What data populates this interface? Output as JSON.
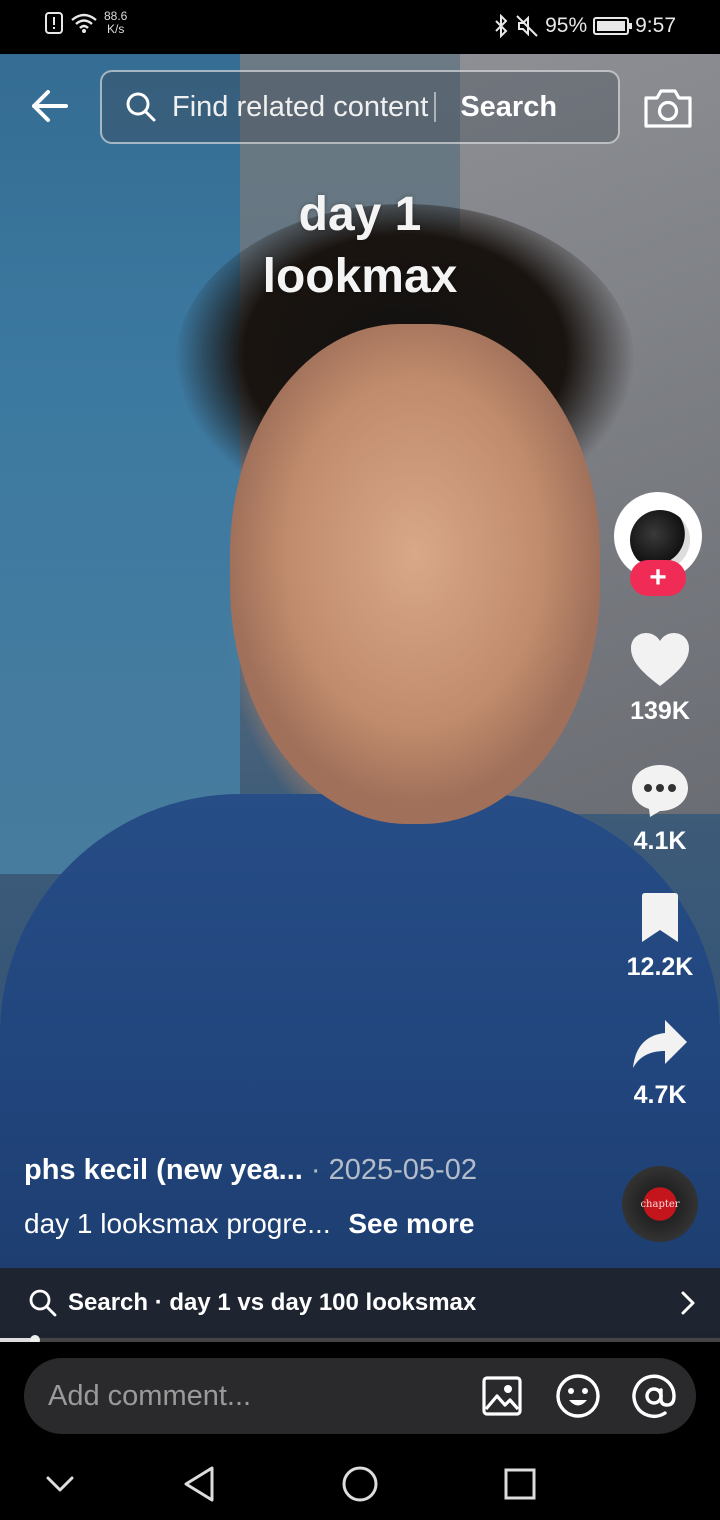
{
  "status_bar": {
    "net_speed_value": "88.6",
    "net_speed_unit": "K/s",
    "battery": "95%",
    "time": "9:57"
  },
  "top_bar": {
    "search_placeholder": "Find related content",
    "search_button": "Search"
  },
  "video": {
    "overlay_line1": "day 1",
    "overlay_line2": "lookmax"
  },
  "rail": {
    "likes": "139K",
    "comments": "4.1K",
    "saves": "12.2K",
    "shares": "4.7K",
    "follow_symbol": "+",
    "music_label": "chapter"
  },
  "caption": {
    "username": "phs kecil (new yea...",
    "date": " · 2025-05-02",
    "text": "day 1 looksmax progre...",
    "see_more": "See more"
  },
  "related_search": {
    "prefix": "Search · ",
    "query": "day 1 vs day 100 looksmax"
  },
  "progress": {
    "fraction": 0.048
  },
  "comment_bar": {
    "placeholder": "Add comment..."
  },
  "colors": {
    "follow_red": "#f02c56",
    "background": "#000000"
  }
}
